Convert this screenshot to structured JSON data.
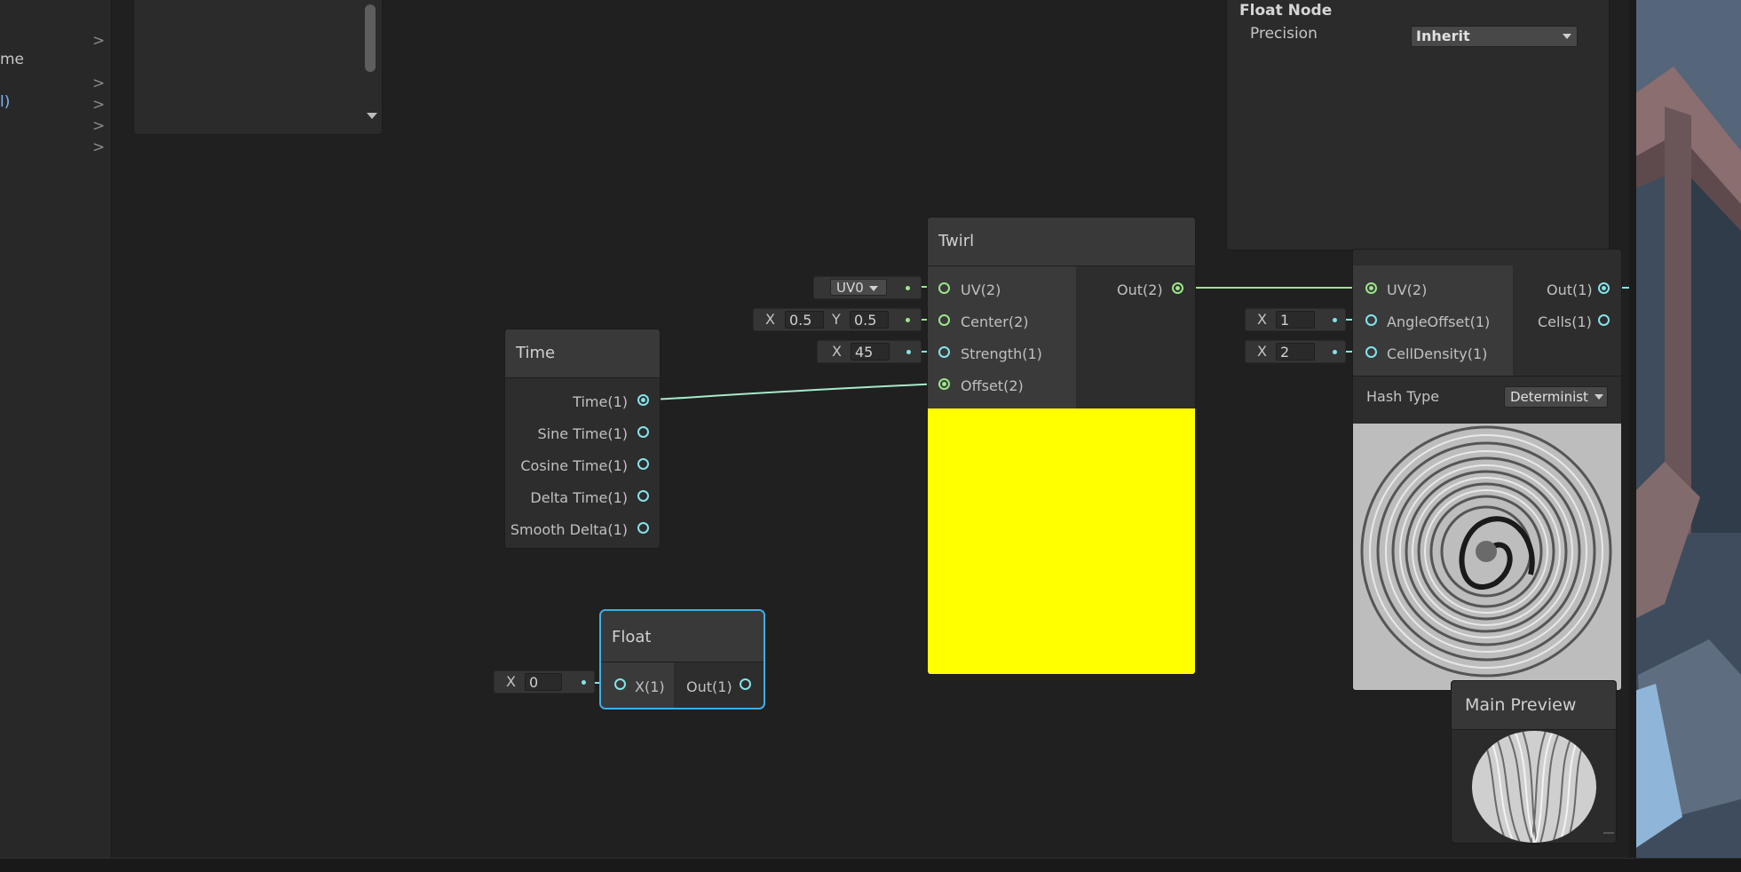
{
  "colors": {
    "background": "#202020",
    "node_body": "#2d2d2d",
    "node_header": "#393939",
    "edge_vector2": "#9be68b",
    "edge_float": "#84e4e7",
    "selected_outline": "#3daee9",
    "twirl_preview": "#ffff00"
  },
  "left_panel": {
    "items": [
      {
        "text": "me",
        "chevron": "chevron-right-icon"
      },
      {
        "text": "",
        "chevron": "chevron-right-icon"
      },
      {
        "text": "l)",
        "chevron": "chevron-right-icon"
      },
      {
        "text": "",
        "chevron": "chevron-right-icon"
      },
      {
        "text": "",
        "chevron": "chevron-right-icon"
      }
    ],
    "chevron_glyph": ">"
  },
  "graph_inspector": {
    "title": "Float Node",
    "precision_label": "Precision",
    "precision_value": "Inherit"
  },
  "time_node": {
    "title": "Time",
    "outputs": [
      "Time(1)",
      "Sine Time(1)",
      "Cosine Time(1)",
      "Delta Time(1)",
      "Smooth Delta(1)"
    ]
  },
  "float_node": {
    "title": "Float",
    "input_label": "X(1)",
    "output_label": "Out(1)",
    "input_field": {
      "axis": "X",
      "value": "0"
    }
  },
  "twirl_node": {
    "title": "Twirl",
    "inputs": [
      "UV(2)",
      "Center(2)",
      "Strength(1)",
      "Offset(2)"
    ],
    "output": "Out(2)",
    "uv_dropdown": "UV0",
    "center_field": {
      "x_label": "X",
      "x_value": "0.5",
      "y_label": "Y",
      "y_value": "0.5"
    },
    "strength_field": {
      "x_label": "X",
      "x_value": "45"
    }
  },
  "voronoi_node": {
    "inputs": [
      "UV(2)",
      "AngleOffset(1)",
      "CellDensity(1)"
    ],
    "outputs": [
      "Out(1)",
      "Cells(1)"
    ],
    "angle_field": {
      "x_label": "X",
      "x_value": "1"
    },
    "density_field": {
      "x_label": "X",
      "x_value": "2"
    },
    "hash_type_label": "Hash Type",
    "hash_type_value": "Determinist"
  },
  "main_preview": {
    "title": "Main Preview"
  }
}
